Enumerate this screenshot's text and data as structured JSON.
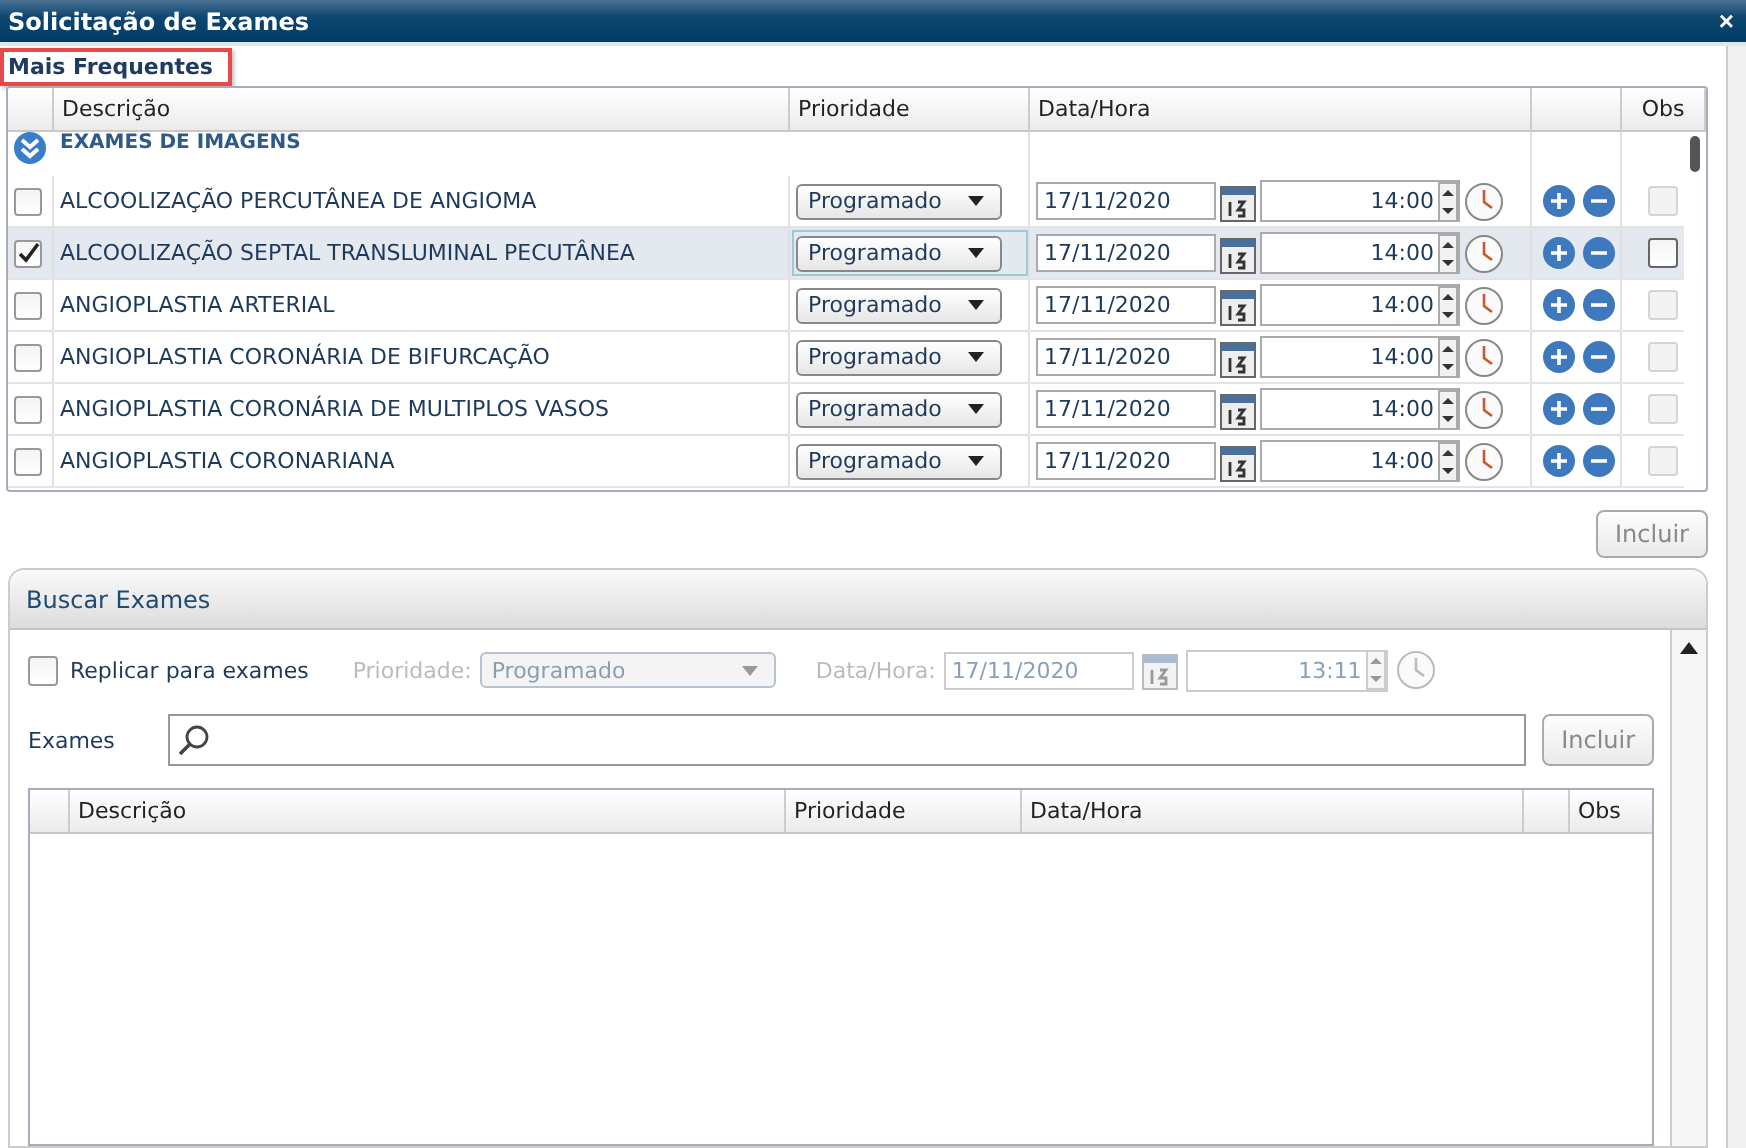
{
  "window": {
    "title": "Solicitação de Exames",
    "close": "×"
  },
  "frequent": {
    "label": "Mais Frequentes",
    "columns": [
      "Descrição",
      "Prioridade",
      "Data/Hora",
      "Obs"
    ],
    "group": "EXAMES DE IMAGENS",
    "rows": [
      {
        "description": "ALCOOLIZAÇÃO PERCUTÂNEA DE ANGIOMA",
        "checked": false,
        "selected": false,
        "priority": "Programado",
        "date": "17/11/2020",
        "time": "14:00",
        "obs_disabled": true
      },
      {
        "description": "ALCOOLIZAÇÃO SEPTAL TRANSLUMINAL PECUTÂNEA",
        "checked": true,
        "selected": true,
        "priority": "Programado",
        "date": "17/11/2020",
        "time": "14:00",
        "obs_disabled": false
      },
      {
        "description": "ANGIOPLASTIA ARTERIAL",
        "checked": false,
        "selected": false,
        "priority": "Programado",
        "date": "17/11/2020",
        "time": "14:00",
        "obs_disabled": true
      },
      {
        "description": "ANGIOPLASTIA CORONÁRIA DE BIFURCAÇÃO",
        "checked": false,
        "selected": false,
        "priority": "Programado",
        "date": "17/11/2020",
        "time": "14:00",
        "obs_disabled": true
      },
      {
        "description": "ANGIOPLASTIA CORONÁRIA DE MULTIPLOS VASOS",
        "checked": false,
        "selected": false,
        "priority": "Programado",
        "date": "17/11/2020",
        "time": "14:00",
        "obs_disabled": true
      },
      {
        "description": "ANGIOPLASTIA CORONARIANA",
        "checked": false,
        "selected": false,
        "priority": "Programado",
        "date": "17/11/2020",
        "time": "14:00",
        "obs_disabled": true
      }
    ],
    "include_button": "Incluir"
  },
  "search": {
    "title": "Buscar Exames",
    "replicate": {
      "label": "Replicar para exames",
      "checked": false
    },
    "priority_label": "Prioridade:",
    "priority": "Programado",
    "datetime_label": "Data/Hora:",
    "date": "17/11/2020",
    "time": "13:11",
    "disabled": true,
    "exams_label": "Exames",
    "include_button": "Incluir",
    "columns": [
      "Descrição",
      "Prioridade",
      "Data/Hora",
      "Obs"
    ]
  }
}
